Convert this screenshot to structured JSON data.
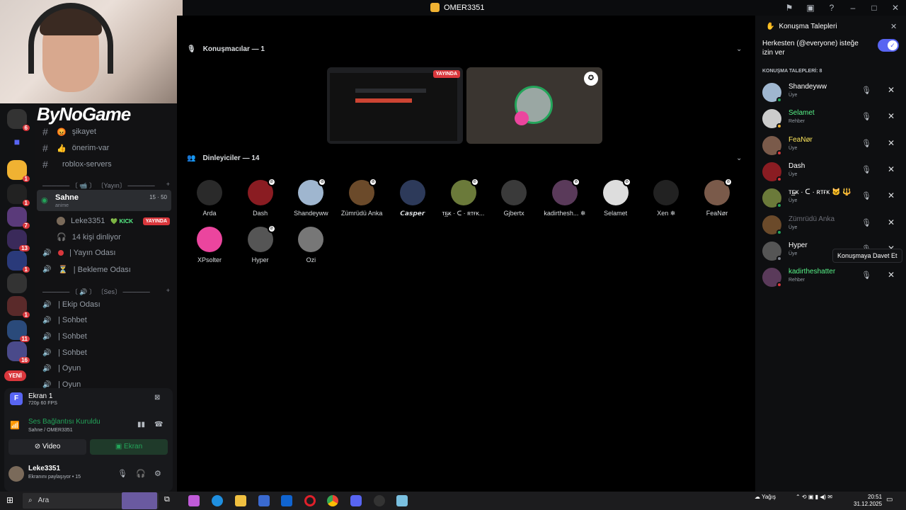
{
  "window": {
    "title": "OMER3351"
  },
  "titlebar_icons": [
    "inbox-icon",
    "screen-icon",
    "help-icon",
    "minimize-icon",
    "maximize-icon",
    "close-icon"
  ],
  "brand": "ByNoGame",
  "channels": {
    "text": [
      {
        "icon": "#",
        "emoji": "😡",
        "label": "şikayet"
      },
      {
        "icon": "#",
        "emoji": "👍",
        "label": "önerim-var"
      },
      {
        "icon": "#",
        "emoji": "",
        "label": "roblox-servers"
      }
    ],
    "category_yayin": "────── 〔 📹 〕 〔Yayın〕 ──────",
    "stage": {
      "name": "Sahne",
      "subtitle": "anime",
      "count": "15",
      "limit": "50"
    },
    "stage_user": {
      "name": "Leke3351",
      "tag": "💚 KICK",
      "badge": "YAYINDA"
    },
    "listeners_text": "14 kişi dinliyor",
    "voice_1": [
      {
        "label": "| Yayın Odası"
      },
      {
        "label": "| Bekleme Odası"
      }
    ],
    "category_ses": "────── 〔 🔊 〕 〔Ses〕 ──────",
    "voice_2": [
      {
        "label": "| Ekip Odası"
      },
      {
        "label": "| Sohbet"
      },
      {
        "label": "| Sohbet"
      },
      {
        "label": "| Sohbet"
      },
      {
        "label": "| Oyun"
      },
      {
        "label": "| Oyun"
      }
    ]
  },
  "rail": {
    "badges": [
      "6",
      "1",
      "1",
      "7",
      "13",
      "1",
      "1",
      "11",
      "16"
    ],
    "new_label": "YENİ"
  },
  "panel": {
    "stream_title": "Ekran 1",
    "stream_quality": "720p 60 FPS",
    "voice_status": "Ses Bağlantısı Kuruldu",
    "voice_location": "Sahne / OMER3351",
    "video_label": "Video",
    "screen_label": "Ekran",
    "user_name": "Leke3351",
    "user_status": "Ekranını paylaşıyor • 15"
  },
  "stage_main": {
    "speakers_header": "Konuşmacılar — 1",
    "live_badge": "YAYINDA",
    "listeners_header": "Dinleyiciler — 14",
    "listeners": [
      {
        "name": "Arda",
        "color": "#2a2a2a",
        "muted": false
      },
      {
        "name": "Dash",
        "color": "#8a1c22",
        "muted": true
      },
      {
        "name": "Shandeyww",
        "color": "#9fb6cf",
        "muted": true
      },
      {
        "name": "Zümrüdü Anka",
        "color": "#6b4a2a",
        "muted": true
      },
      {
        "name": "𝘾𝙖𝙨𝙥𝙚𝙧",
        "color": "#2d3a5a",
        "muted": false
      },
      {
        "name": "ᴛ͢ᴇ̵ᴋ · ᑕ · ʀᴛғᴋ...",
        "color": "#6b7a3a",
        "muted": true
      },
      {
        "name": "Gjbertx",
        "color": "#3a3a3a",
        "muted": false
      },
      {
        "name": "kadirthesh... ❄",
        "color": "#5a3a5a",
        "muted": true
      },
      {
        "name": "Selamet",
        "color": "#ddd",
        "muted": true
      },
      {
        "name": "Xen ❄",
        "color": "#222",
        "muted": false
      },
      {
        "name": "FeaNør",
        "color": "#7a5a4a",
        "muted": true
      },
      {
        "name": "XPsolter",
        "color": "#eb459e",
        "muted": false
      },
      {
        "name": "Hyper",
        "color": "#555",
        "muted": true
      },
      {
        "name": "Ozi",
        "color": "#777",
        "muted": false
      }
    ]
  },
  "requests_panel": {
    "title": "Konuşma Talepleri",
    "allow_label_line1": "Herkesten (@everyone) isteğe",
    "allow_label_line2": "izin ver",
    "allow_enabled": true,
    "section_label": "KONUŞMA TALEPLERİ: 8",
    "requests": [
      {
        "name": "Shandeyww",
        "role": "Üye",
        "name_color": "#ffffff",
        "avatar_color": "#9fb6cf",
        "status": "#23a55a"
      },
      {
        "name": "Selamet",
        "role": "Rehber",
        "name_color": "#57f287",
        "avatar_color": "#cccccc",
        "status": "#f0b232"
      },
      {
        "name": "FeaNør",
        "role": "Üye",
        "name_color": "#fee75c",
        "avatar_color": "#7a5a4a",
        "status": "#da373c"
      },
      {
        "name": "Dash",
        "role": "Üye",
        "name_color": "#ffffff",
        "avatar_color": "#8a1c22",
        "status": "#da373c"
      },
      {
        "name": "ᴛ͢ᴇ̵ᴋ · ᑕ · ʀᴛғᴋ 🐱 🔱",
        "role": "Üye",
        "name_color": "#ffffff",
        "avatar_color": "#6b7a3a",
        "status": "#23a55a"
      },
      {
        "name": "Zümrüdü Anka",
        "role": "Üye",
        "name_color": "#6d6f78",
        "avatar_color": "#6b4a2a",
        "status": "#23a55a"
      },
      {
        "name": "Hyper",
        "role": "Üye",
        "name_color": "#ffffff",
        "avatar_color": "#555555",
        "status": "#80848e"
      },
      {
        "name": "kadirtheshatter",
        "role": "Rehber",
        "name_color": "#57f287",
        "avatar_color": "#5a3a5a",
        "status": "#da373c"
      }
    ],
    "tooltip": "Konuşmaya Davet Et"
  },
  "taskbar": {
    "search_placeholder": "Ara",
    "weather": "Yağış",
    "time": "20:51",
    "date": "31.12.2025"
  }
}
